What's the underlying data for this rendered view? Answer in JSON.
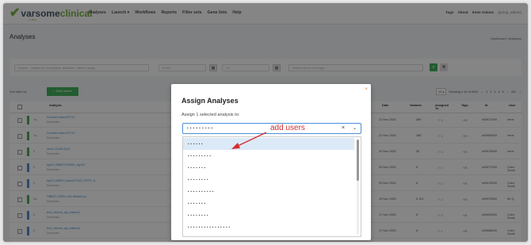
{
  "app": {
    "brand_part1": "varsome",
    "brand_part2": "clinical",
    "version": "v1.88.0",
    "menu": [
      "Analyses",
      "Launch ▾",
      "Workflows",
      "Reports",
      "Filter sets",
      "Gene lists",
      "Help"
    ],
    "right_menu": [
      "Tags",
      "About",
      "Irene Adams",
      "(group_admin)"
    ]
  },
  "page": {
    "title": "Analyses",
    "breadcrumb": "Dashboard  /  Analyses"
  },
  "filters": {
    "search_placeholder": "Search... subject id, phenotypes, diseases, variant, assay",
    "from_placeholder": "From...",
    "to_placeholder": "To...",
    "tags_placeholder": "Select one or more tags...",
    "calendar_glyph": "▦",
    "search_glyph": "⌕",
    "reset_glyph": "⊗",
    "dropdown_glyph": "⌄"
  },
  "toolbar": {
    "sort_label": "Sort table by:",
    "add_button": "+  Date Added",
    "page_size": "10 ▴",
    "showing": "Showing 1-10 of 4023",
    "pages": [
      "←",
      "1",
      "2",
      "3",
      "4",
      "5",
      "...",
      "401",
      "→"
    ]
  },
  "table": {
    "headers": [
      "Analysis",
      "Date",
      "Variants",
      "Assigned To",
      "Tags",
      "Id",
      "User"
    ],
    "rows": [
      {
        "version": "3 ▸",
        "name": "Somedi initial.CR713",
        "desc": "Description",
        "date": "21 Nov 2025",
        "variants": "389",
        "assigned": "1",
        "tags": "+⊙",
        "id": "#49671000",
        "user": "Irene",
        "bar": "#43b05c"
      },
      {
        "version": "3 ▸",
        "name": "Somedi initial.CR713",
        "desc": "Description",
        "date": "21 Nov 2025",
        "variants": "188",
        "assigned": "1",
        "tags": "+⊙",
        "id": "#49680000",
        "user": "Irene",
        "bar": "#43b05c"
      },
      {
        "version": "3",
        "name": "short.21428.3113",
        "desc": "Description",
        "date": "20 Nov 2025",
        "variants": "35",
        "assigned": "3",
        "tags": "+⊙",
        "id": "#49678000",
        "user": "Irene",
        "bar": "#43b05c"
      },
      {
        "version": "3",
        "name": "hg19_HBB27215945_Ag100",
        "desc": "Description",
        "date": "20 Nov 2025",
        "variants": "8",
        "assigned": "2",
        "tags": "+⊙",
        "id": "#49677000",
        "user": "Chen Santo",
        "bar": "#4a90d9"
      },
      {
        "version": "3",
        "name": "hg19_HBB27.pubue27245_P3TR_N",
        "desc": "Description",
        "date": "20 Nov 2025",
        "variants": "8",
        "assigned": "2",
        "tags": "+⊙",
        "id": "#49676000",
        "user": "Chen Santo",
        "bar": "#4a90d9"
      },
      {
        "version": "3 ▸",
        "name": "HBB27.CDR1.m01.MultiAnno",
        "desc": "Description",
        "date": "19 Nov 2025",
        "variants": "5 124",
        "assigned": "2",
        "tags": "+⊙",
        "id": "#49675000",
        "user": "Mr Q",
        "bar": "#43b05c"
      },
      {
        "version": "3",
        "name": "test_clinical_api_babies2",
        "desc": "Description",
        "date": "17 Nov 2025",
        "variants": "8",
        "assigned": "2",
        "tags": "+⊙",
        "id": "#49669000",
        "user": "Chen Santo",
        "bar": "#4a90d9"
      },
      {
        "version": "3",
        "name": "test_clinical_api_babies2",
        "desc": "Description",
        "date": "17 Nov 2025",
        "variants": "8",
        "assigned": "1",
        "tags": "+⊙",
        "id": "#49668000",
        "user": "Chen Santo",
        "bar": "#4a90d9"
      }
    ]
  },
  "modal": {
    "title": "Assign Analyses",
    "subtitle": "Assign 1 selected analysis to:",
    "select_value": "• • • •   • • • •   •",
    "clear_glyph": "×",
    "chevron_glyph": "⌄",
    "close_glyph": "×",
    "options": [
      "• • • • • •",
      "• • • • • • • • •",
      "• • • • • • •",
      "• • • • • • • •",
      "• • • • • • • • • •",
      "• • • • • • •",
      "• • • • • • • •",
      "• • • • • • • • • • • • • • • •",
      "• • • • • • • • • •"
    ]
  },
  "annotation": {
    "text": "add users",
    "color": "#d32f2f"
  }
}
